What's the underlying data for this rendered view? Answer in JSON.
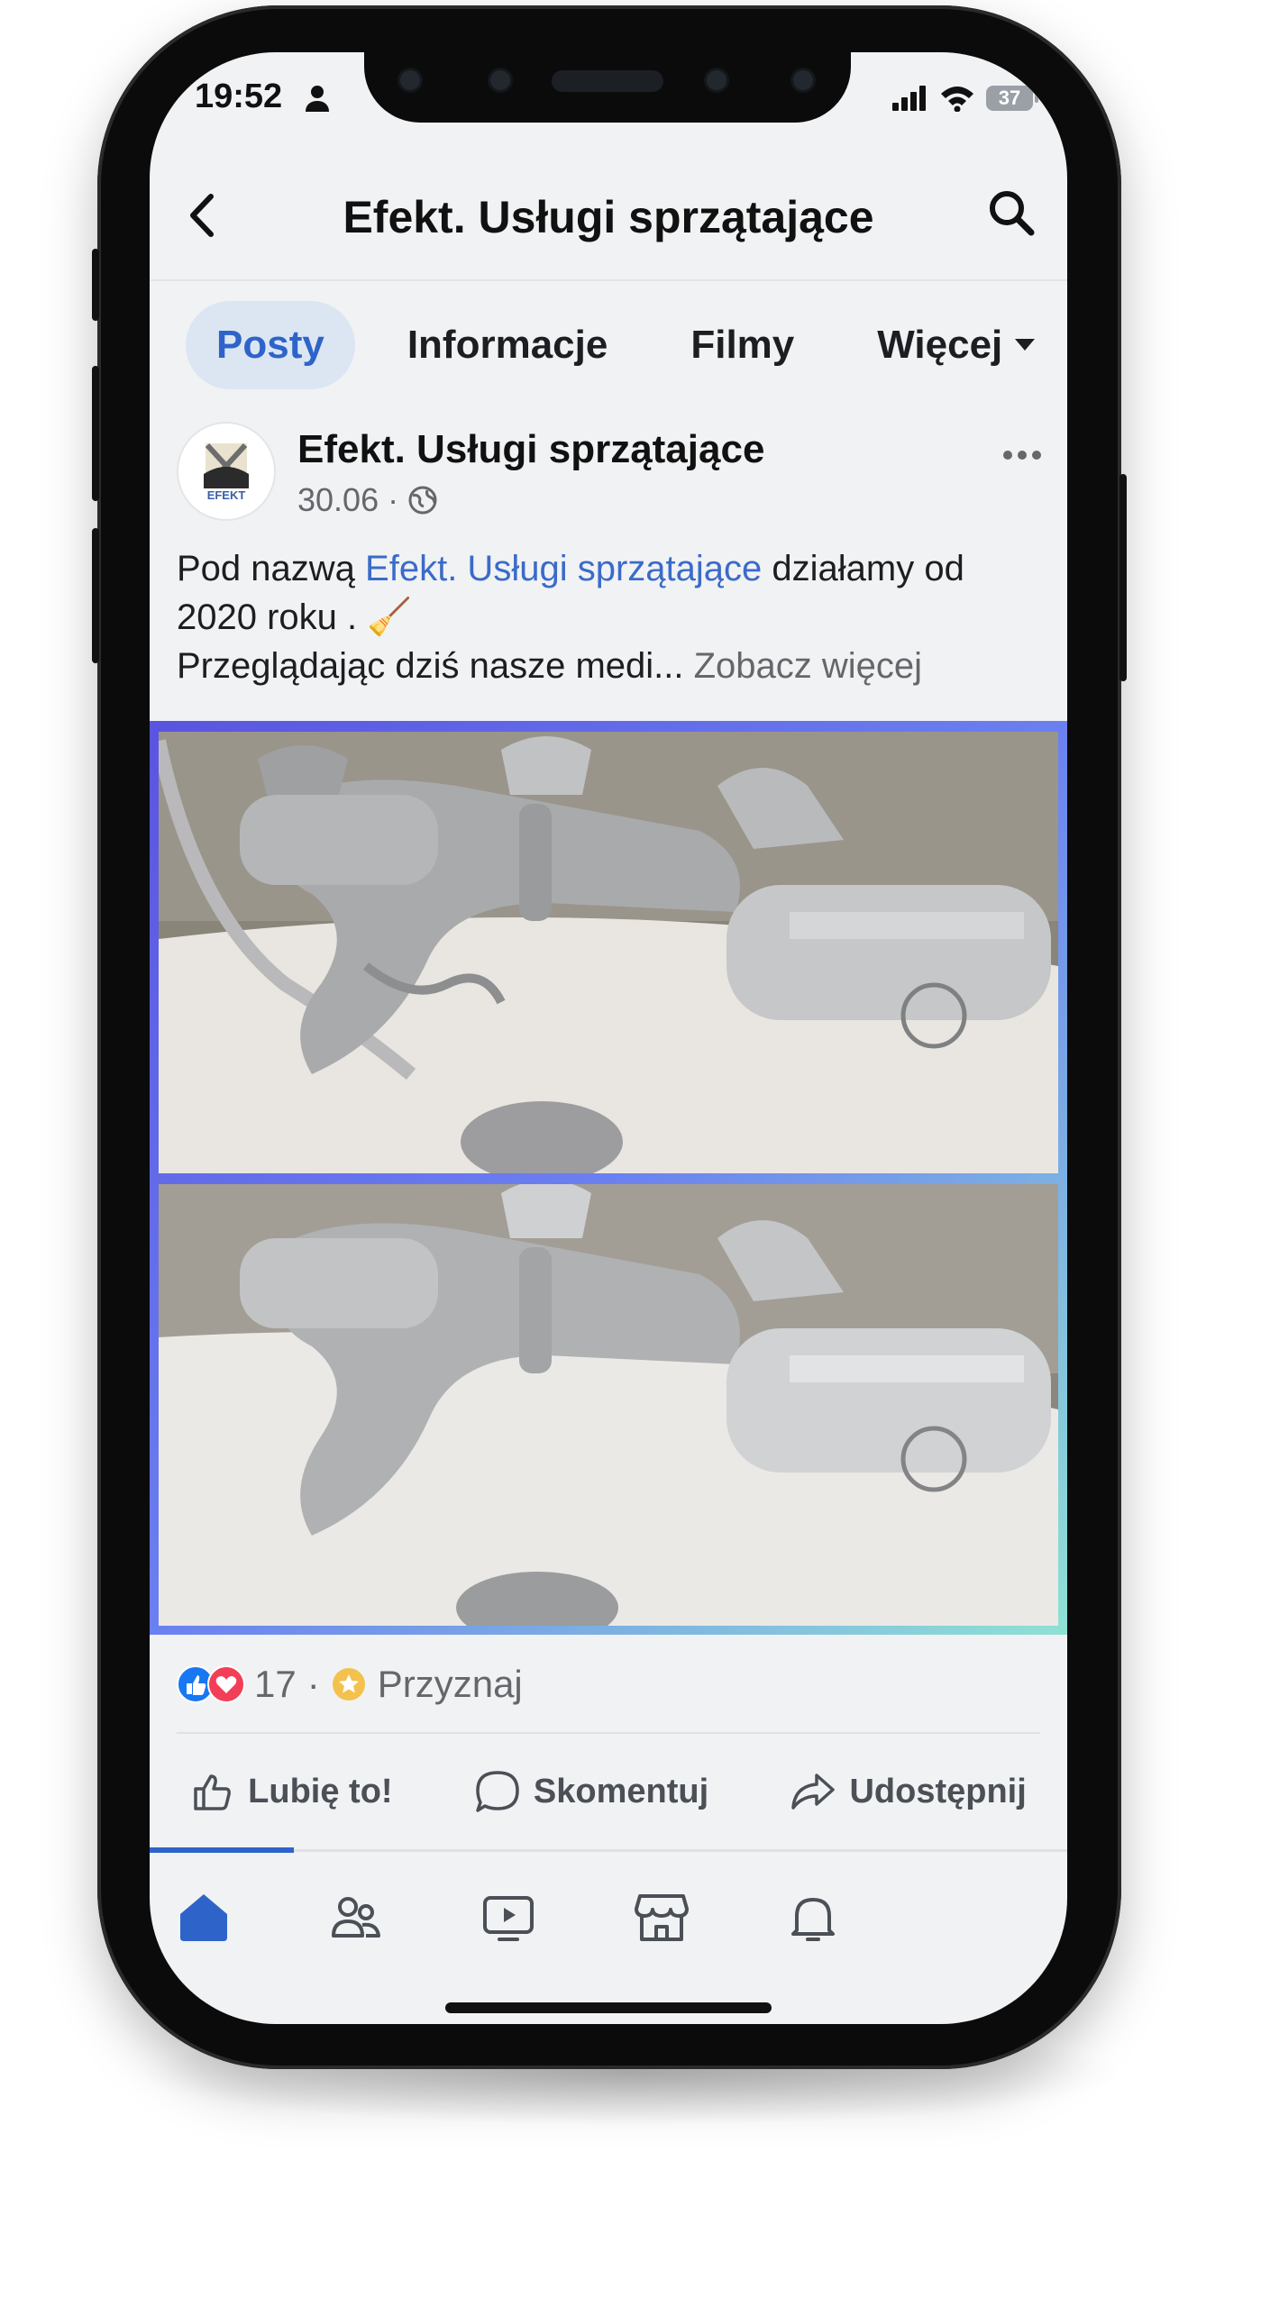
{
  "status_bar": {
    "time": "19:52",
    "battery": "37"
  },
  "header": {
    "title": "Efekt. Usługi sprzątające"
  },
  "tabs": [
    {
      "label": "Posty"
    },
    {
      "label": "Informacje"
    },
    {
      "label": "Filmy"
    },
    {
      "label": "Więcej"
    }
  ],
  "post": {
    "author": "Efekt. Usługi sprzątające",
    "date": "30.06",
    "date_sep": "·",
    "avatar_text": "EFEKT",
    "text_prefix": "Pod nazwą",
    "text_link": "Efekt. Usługi sprzątające",
    "text_suffix": "działamy od 2020 roku .",
    "text_emoji": "🧹",
    "text_line3": "Przeglądając dziś nasze medi...",
    "see_more": "Zobacz więcej",
    "photo_before_desc": "",
    "reaction_count": "17",
    "reaction_sep": "·",
    "award_label": "Przyznaj"
  },
  "actions": {
    "like": "Lubię to!",
    "comment": "Skomentuj",
    "share": "Udostępnij"
  },
  "colors": {
    "accent": "#2e64c9",
    "link": "#3a6bc9",
    "like_blue": "#1877f2",
    "love_red": "#f33e58"
  }
}
